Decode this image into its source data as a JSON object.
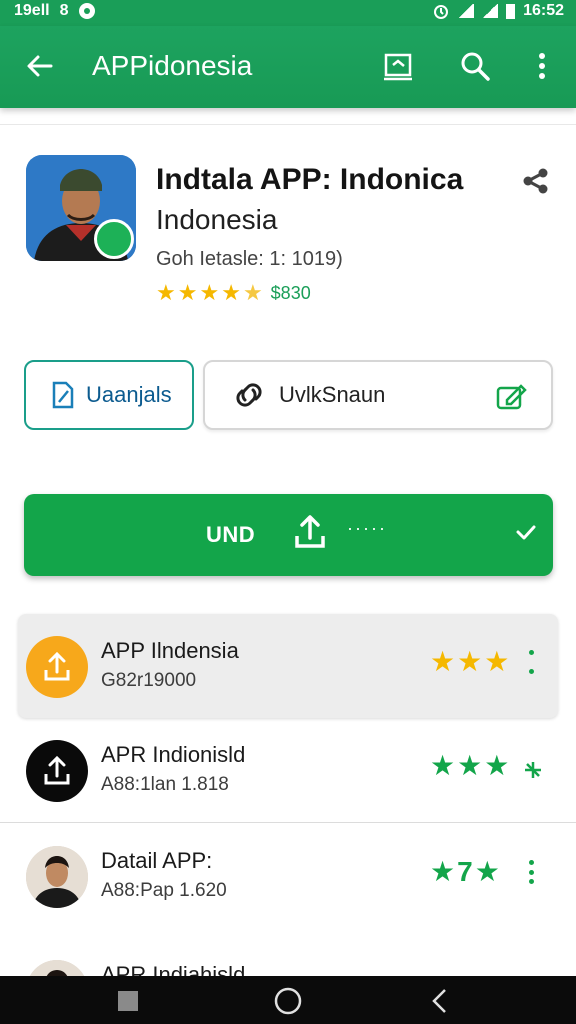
{
  "status_bar": {
    "time_left": "19ell",
    "left_symbol": "8",
    "time_right": "16:52"
  },
  "app_bar": {
    "title": "APPidonesia",
    "icons": [
      "back-arrow-icon",
      "crop-icon",
      "search-icon",
      "more-vert-icon"
    ]
  },
  "app": {
    "title": "Indtala APP: Indonica",
    "subtitle": "Indonesia",
    "meta": "Goh Ietasle: 1: 1019)",
    "rating_value": 4.5,
    "rating_count": "$830",
    "stars": [
      "★",
      "★",
      "★",
      "★",
      "★"
    ]
  },
  "buttons": {
    "primary_outline": {
      "label": "Uaanjals",
      "icon": "document-icon"
    },
    "secondary_outline": {
      "label": "UvlkSnaun",
      "icon": "link-icon",
      "trailing_icon": "edit-icon"
    },
    "install": {
      "label": "UND",
      "dots": "·····",
      "icon": "upload-icon",
      "trailing_icon": "check-icon"
    }
  },
  "list": [
    {
      "name": "APP Ilndensia",
      "meta": "G82r19000",
      "stars": [
        "★",
        "★",
        "★"
      ],
      "star_color": "#f5b800",
      "avatar": "upload-icon",
      "highlighted": true
    },
    {
      "name": "APR Indionisld",
      "meta": "A88:1lan 1.818",
      "stars": [
        "★",
        "★",
        "★"
      ],
      "star_color": "#13a54a",
      "avatar": "upload-icon",
      "highlighted": false
    },
    {
      "name": "Datail APP:",
      "meta": "A88:Pap 1.620",
      "stars": [
        "★",
        "7",
        "★"
      ],
      "star_color": "#13a54a",
      "avatar": "person-photo",
      "highlighted": false
    },
    {
      "name": "APR Indiahisld",
      "meta": "",
      "stars": [],
      "star_color": "#13a54a",
      "avatar": "person-photo",
      "highlighted": false
    }
  ],
  "colors": {
    "brand_green": "#1a9e58",
    "install_green": "#13a54a",
    "star_yellow": "#f5b800",
    "accent_orange": "#f7a81b"
  }
}
